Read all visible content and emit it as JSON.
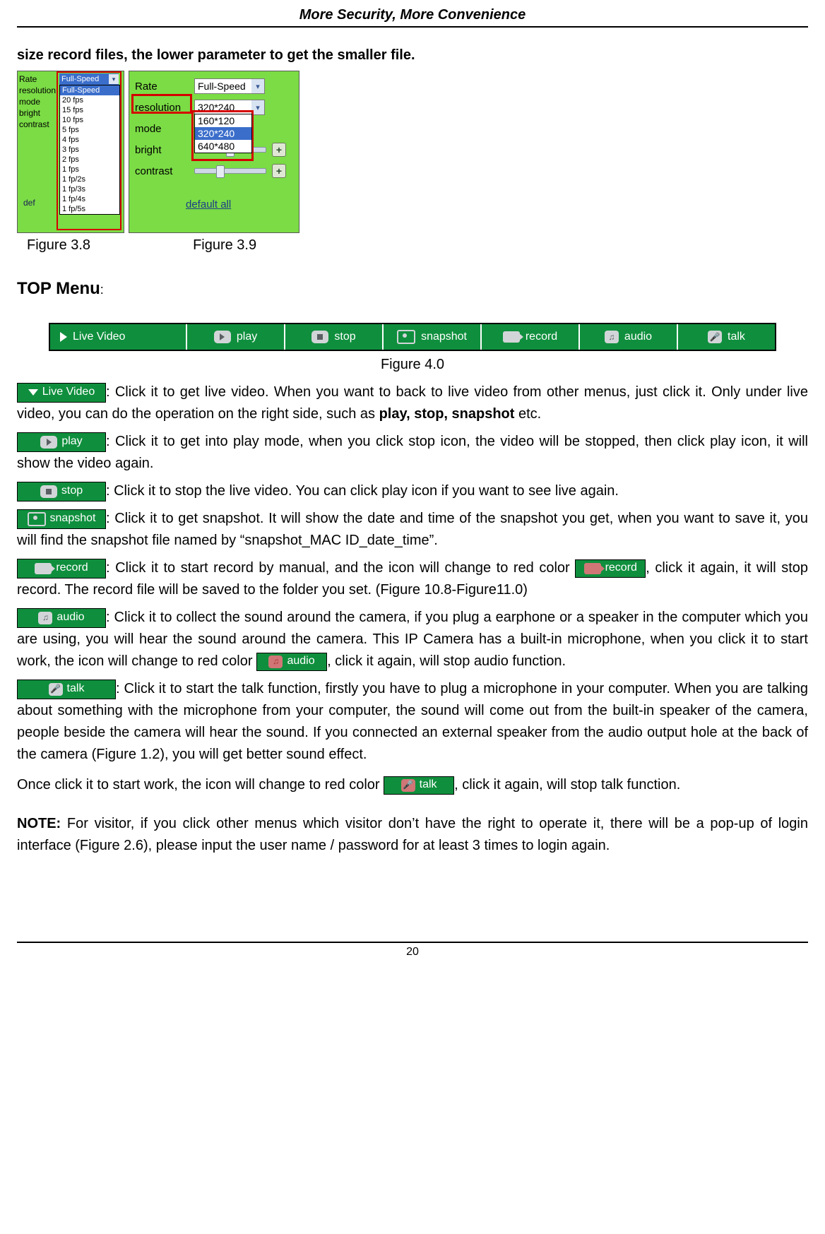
{
  "header": {
    "title": "More Security, More Convenience"
  },
  "intro_bold": "size record files, the lower parameter to get the smaller file.",
  "fig38": {
    "labels": [
      "Rate",
      "resolution",
      "mode",
      "bright",
      "contrast"
    ],
    "selected": "Full-Speed",
    "rate_options": [
      "Full-Speed",
      "20 fps",
      "15 fps",
      "10 fps",
      "5 fps",
      "4 fps",
      "3 fps",
      "2 fps",
      "1 fps",
      "1 fp/2s",
      "1 fp/3s",
      "1 fp/4s",
      "1 fp/5s"
    ],
    "def_label": "def"
  },
  "fig39": {
    "rows": {
      "rate_label": "Rate",
      "rate_value": "Full-Speed",
      "resolution_label": "resolution",
      "resolution_value": "320*240",
      "mode_label": "mode",
      "bright_label": "bright",
      "contrast_label": "contrast"
    },
    "res_options": [
      "160*120",
      "320*240",
      "640*480"
    ],
    "default_all": "default all"
  },
  "fig_captions": {
    "c38": "Figure 3.8",
    "c39": "Figure 3.9"
  },
  "top_menu_heading": "TOP Menu",
  "menubar": {
    "live_video": "Live Video",
    "play": "play",
    "stop": "stop",
    "snapshot": "snapshot",
    "record": "record",
    "audio": "audio",
    "talk": "talk"
  },
  "fig40_caption": "Figure 4.0",
  "buttons": {
    "live_video": "Live Video",
    "play": "play",
    "stop": "stop",
    "snapshot": "snapshot",
    "record": "record",
    "record_red": "record",
    "audio": "audio",
    "audio_red": "audio",
    "talk": "talk",
    "talk_red": "talk"
  },
  "paras": {
    "live_a": ": Click it to get live video. When you want to back to live video from other menus, just click it. Only under live video, you can do the operation on the right side, such as ",
    "live_bold": "play, stop, snapshot",
    "live_b": " etc.",
    "play": ": Click it to get into play mode, when you click stop icon, the video will be stopped, then click play icon, it will show the video again.",
    "stop": ": Click it to stop the live video. You can click play icon if you want to see live again.",
    "snapshot": ": Click it to get snapshot. It will show the date and time of the snapshot you get, when you want to save it, you will find the snapshot file named by “snapshot_MAC ID_date_time”.",
    "record_a": ": Click it to start record by manual, and the icon will change to red color",
    "record_b": ", click it again, it will stop record. The record file will be saved to the folder you set. (Figure 10.8-Figure11.0)",
    "audio_a": ": Click it to collect the sound around the camera, if you plug a earphone or a speaker in the computer which you are using, you will hear the sound around the camera. This IP Camera has a built-in microphone, when you click it to start work, the icon will change to red color",
    "audio_b": ", click it again, will stop audio function.",
    "talk_a": ": Click it to start the talk function, firstly you have to plug a microphone in your computer. When you are talking about something with the microphone from your computer, the sound will come out from the built-in speaker of the camera, people beside the camera will hear the sound. If you connected an external speaker from the audio output hole at the back of the camera (Figure 1.2), you will get better sound effect.",
    "talk_b": "Once click it to start work, the icon will change to red color",
    "talk_c": ", click it again, will stop talk function.",
    "note_label": "NOTE:",
    "note_body": " For visitor, if you click other menus which visitor don’t have the right to operate it, there will be a pop-up of login interface (Figure 2.6), please input the user name / password for at least 3 times to login again."
  },
  "page_number": "20"
}
